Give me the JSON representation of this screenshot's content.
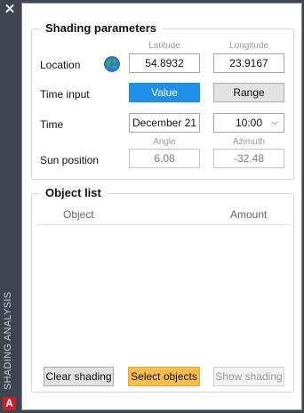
{
  "rail": {
    "close_symbol": "✕",
    "title": "SHADING ANALYSIS",
    "logo_letter": "A"
  },
  "shading": {
    "title": "Shading parameters",
    "latitude_header": "Latitude",
    "longitude_header": "Longitude",
    "location_label": "Location",
    "latitude": "54.8932",
    "longitude": "23.9167",
    "time_input_label": "Time input",
    "value_button": "Value",
    "range_button": "Range",
    "time_label": "Time",
    "date": "December 21",
    "time": "10:00",
    "angle_header": "Angle",
    "azimuth_header": "Azimuth",
    "sun_position_label": "Sun position",
    "angle": "6.08",
    "azimuth": "-32.48"
  },
  "objects": {
    "title": "Object list",
    "col_object": "Object",
    "col_amount": "Amount",
    "clear_button": "Clear shading",
    "select_button": "Select objects",
    "show_button": "Show shading"
  },
  "colors": {
    "accent": "#1e90e8",
    "select_button": "#fbbd4c"
  }
}
